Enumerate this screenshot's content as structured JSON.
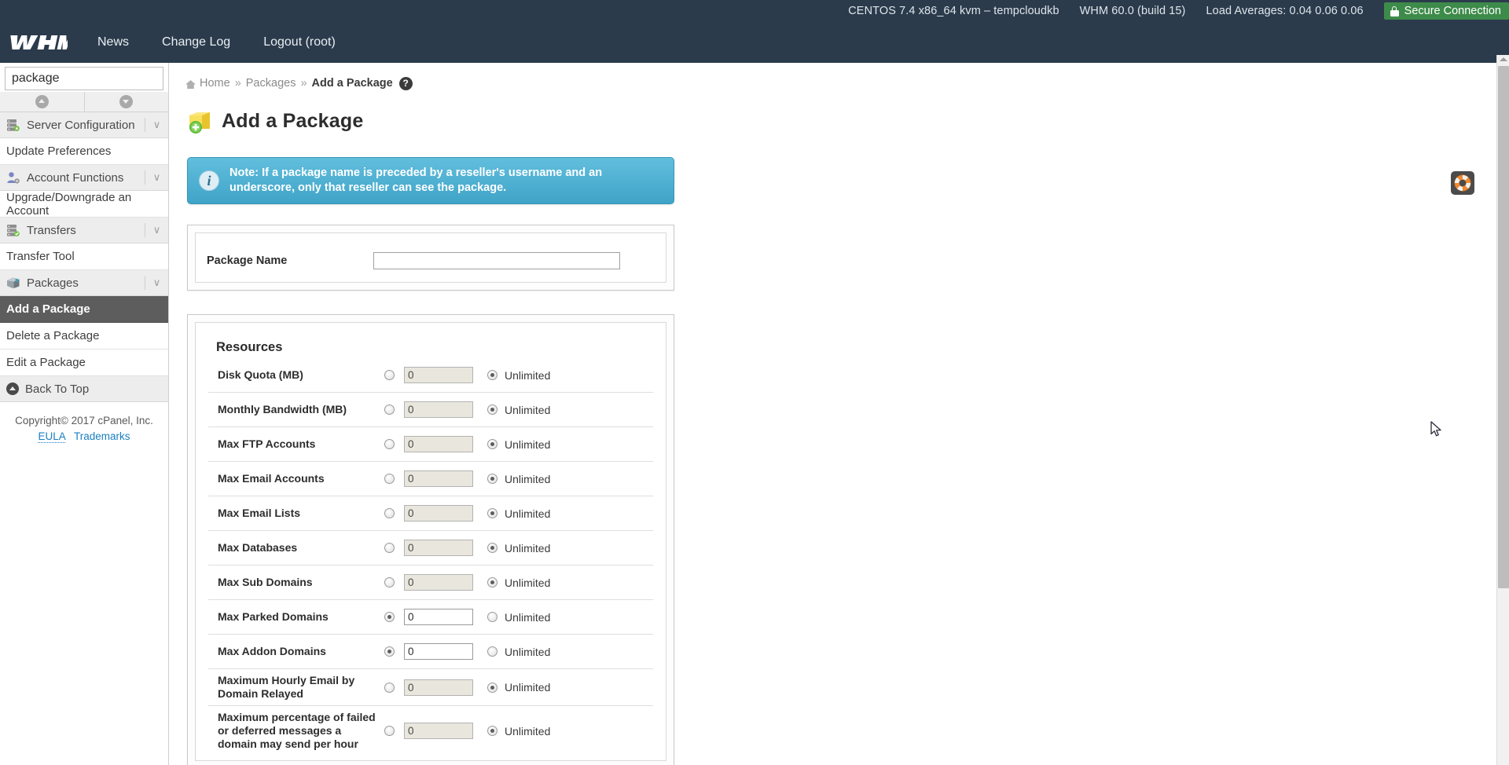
{
  "topbar": {
    "server_info": "CENTOS 7.4 x86_64 kvm – tempcloudkb",
    "whm_version": "WHM 60.0 (build 15)",
    "load_averages": "Load Averages: 0.04 0.06 0.06",
    "secure_connection": "Secure Connection"
  },
  "header": {
    "logo": "WHM",
    "links": [
      {
        "label": "News"
      },
      {
        "label": "Change Log"
      },
      {
        "label": "Logout (root)"
      }
    ]
  },
  "sidebar": {
    "search": {
      "value": "package",
      "placeholder": ""
    },
    "clear_icon": "×",
    "nav_up_icon": "chevron-up-icon",
    "nav_down_icon": "chevron-down-icon",
    "chevron": "∨",
    "groups": [
      {
        "category": "Server Configuration",
        "icon": "server-icon",
        "items": [
          {
            "label": "Update Preferences",
            "active": false
          }
        ]
      },
      {
        "category": "Account Functions",
        "icon": "user-icon",
        "items": [
          {
            "label": "Upgrade/Downgrade an Account",
            "active": false
          }
        ]
      },
      {
        "category": "Transfers",
        "icon": "transfers-icon",
        "items": [
          {
            "label": "Transfer Tool",
            "active": false
          }
        ]
      },
      {
        "category": "Packages",
        "icon": "package-icon",
        "items": [
          {
            "label": "Add a Package",
            "active": true
          },
          {
            "label": "Delete a Package",
            "active": false
          },
          {
            "label": "Edit a Package",
            "active": false
          }
        ]
      }
    ],
    "back_to_top": "Back To Top",
    "copyright": "Copyright© 2017 cPanel, Inc.",
    "eula": "EULA",
    "trademarks": "Trademarks"
  },
  "breadcrumb": {
    "home": "Home",
    "separator": "»",
    "parent": "Packages",
    "current": "Add a Package",
    "help_icon": "?"
  },
  "page": {
    "title": "Add a Package",
    "icon": "add-package-icon",
    "help_fab_icon": "lifesaver-icon"
  },
  "notice": {
    "icon": "info-icon",
    "text": "Note: If a package name is preceded by a reseller's username and an underscore, only that reseller can see the package."
  },
  "package_name": {
    "label": "Package Name",
    "value": "",
    "placeholder": ""
  },
  "resources": {
    "title": "Resources",
    "unlimited_label": "Unlimited",
    "rows": [
      {
        "label": "Disk Quota (MB)",
        "value": "0",
        "mode": "unlimited"
      },
      {
        "label": "Monthly Bandwidth (MB)",
        "value": "0",
        "mode": "unlimited"
      },
      {
        "label": "Max FTP Accounts",
        "value": "0",
        "mode": "unlimited"
      },
      {
        "label": "Max Email Accounts",
        "value": "0",
        "mode": "unlimited"
      },
      {
        "label": "Max Email Lists",
        "value": "0",
        "mode": "unlimited"
      },
      {
        "label": "Max Databases",
        "value": "0",
        "mode": "unlimited"
      },
      {
        "label": "Max Sub Domains",
        "value": "0",
        "mode": "unlimited"
      },
      {
        "label": "Max Parked Domains",
        "value": "0",
        "mode": "number"
      },
      {
        "label": "Max Addon Domains",
        "value": "0",
        "mode": "number"
      },
      {
        "label": "Maximum Hourly Email by Domain Relayed",
        "value": "0",
        "mode": "unlimited"
      },
      {
        "label": "Maximum percentage of failed or deferred messages a domain may send per hour",
        "value": "0",
        "mode": "unlimited"
      }
    ]
  },
  "colors": {
    "topbar": "#2b3b4c",
    "secure_green": "#3d8b4a",
    "notice_blue": "#3fa4c8",
    "active_item": "#5d5d5d",
    "link_blue": "#1a7fc1"
  }
}
